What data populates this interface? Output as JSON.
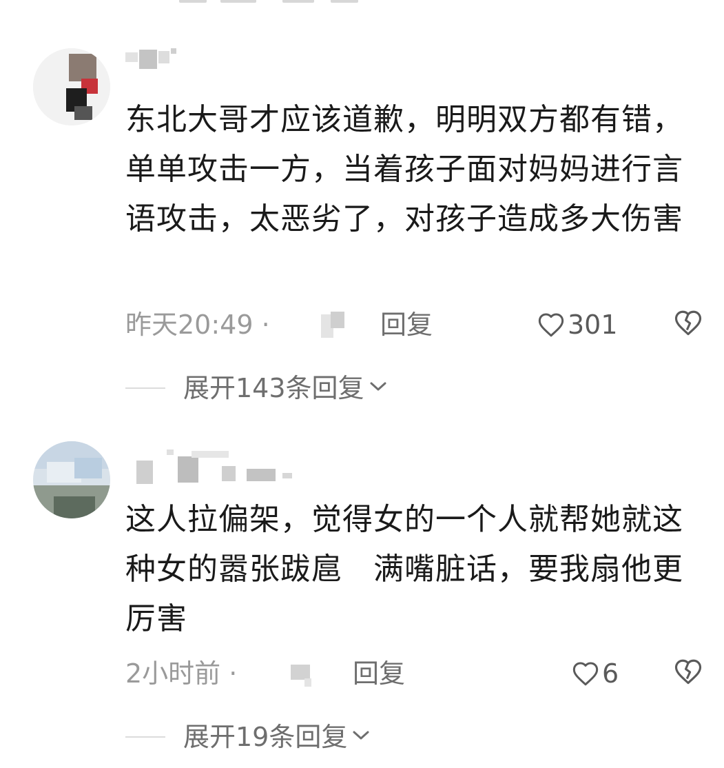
{
  "comments": [
    {
      "text": "东北大哥才应该道歉，明明双方都有错，单单攻击一方，当着孩子面对妈妈进行言语攻击，太恶劣了，对孩子造成多大伤害",
      "time": "昨天20:49 ·",
      "reply_label": "回复",
      "like_count": "301",
      "expand_label": "展开143条回复"
    },
    {
      "text": "这人拉偏架，觉得女的一个人就帮她就这种女的嚣张跋扈　满嘴脏话，要我扇他更厉害",
      "time": "2小时前 ·",
      "reply_label": "回复",
      "like_count": "6",
      "expand_label": "展开19条回复"
    }
  ],
  "icons": {
    "like": "heart-outline-icon",
    "dislike": "broken-heart-icon",
    "expand": "chevron-down-icon"
  },
  "colors": {
    "text": "#1a1a1a",
    "meta": "#9a9a9a",
    "action": "#6e6e6e",
    "background": "#ffffff"
  }
}
